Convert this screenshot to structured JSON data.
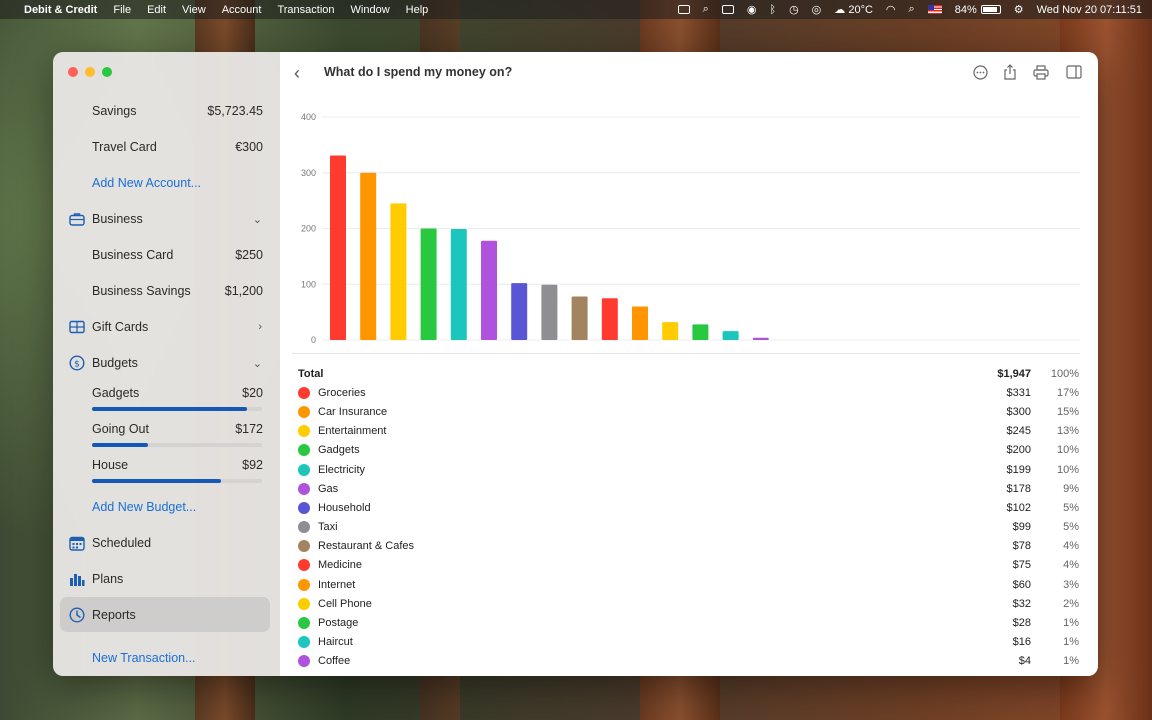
{
  "menubar": {
    "app_name": "Debit & Credit",
    "menus": [
      "File",
      "Edit",
      "View",
      "Account",
      "Transaction",
      "Window",
      "Help"
    ],
    "weather": "20°C",
    "battery": "84%",
    "clock": "Wed Nov 20  07:11:51"
  },
  "sidebar": {
    "accounts": [
      {
        "label": "Savings",
        "amount": "$5,723.45"
      },
      {
        "label": "Travel Card",
        "amount": "€300"
      }
    ],
    "add_account": "Add New Account...",
    "business": {
      "label": "Business",
      "items": [
        {
          "label": "Business Card",
          "amount": "$250"
        },
        {
          "label": "Business Savings",
          "amount": "$1,200"
        }
      ]
    },
    "gift_cards": "Gift Cards",
    "budgets": {
      "label": "Budgets",
      "items": [
        {
          "label": "Gadgets",
          "amount": "$20",
          "progress": 0.91
        },
        {
          "label": "Going Out",
          "amount": "$172",
          "progress": 0.33
        },
        {
          "label": "House",
          "amount": "$92",
          "progress": 0.76
        }
      ]
    },
    "add_budget": "Add New Budget...",
    "scheduled": "Scheduled",
    "plans": "Plans",
    "reports": "Reports",
    "new_transaction": "New Transaction..."
  },
  "main": {
    "title": "What do I spend my money on?"
  },
  "chart_data": {
    "type": "bar",
    "categories": [
      "Groceries",
      "Car Insurance",
      "Entertainment",
      "Gadgets",
      "Electricity",
      "Gas",
      "Household",
      "Taxi",
      "Restaurant & Cafes",
      "Medicine",
      "Internet",
      "Cell Phone",
      "Postage",
      "Haircut",
      "Coffee"
    ],
    "values": [
      331,
      300,
      245,
      200,
      199,
      178,
      102,
      99,
      78,
      75,
      60,
      32,
      28,
      16,
      4
    ],
    "colors": [
      "#ff3b30",
      "#ff9500",
      "#ffcc00",
      "#28c840",
      "#1bc6bc",
      "#af52de",
      "#5856d6",
      "#8e8e93",
      "#a2845e",
      "#ff3b30",
      "#ff9500",
      "#ffcc00",
      "#28c840",
      "#1bc6bc",
      "#af52de"
    ],
    "yticks": [
      0,
      100,
      200,
      300,
      400
    ],
    "ylim": [
      0,
      400
    ],
    "grid": true
  },
  "table": {
    "total": {
      "label": "Total",
      "amount": "$1,947",
      "pct": "100%"
    },
    "rows": [
      {
        "label": "Groceries",
        "amount": "$331",
        "pct": "17%",
        "color": "#ff3b30"
      },
      {
        "label": "Car Insurance",
        "amount": "$300",
        "pct": "15%",
        "color": "#ff9500"
      },
      {
        "label": "Entertainment",
        "amount": "$245",
        "pct": "13%",
        "color": "#ffcc00"
      },
      {
        "label": "Gadgets",
        "amount": "$200",
        "pct": "10%",
        "color": "#28c840"
      },
      {
        "label": "Electricity",
        "amount": "$199",
        "pct": "10%",
        "color": "#1bc6bc"
      },
      {
        "label": "Gas",
        "amount": "$178",
        "pct": "9%",
        "color": "#af52de"
      },
      {
        "label": "Household",
        "amount": "$102",
        "pct": "5%",
        "color": "#5856d6"
      },
      {
        "label": "Taxi",
        "amount": "$99",
        "pct": "5%",
        "color": "#8e8e93"
      },
      {
        "label": "Restaurant & Cafes",
        "amount": "$78",
        "pct": "4%",
        "color": "#a2845e"
      },
      {
        "label": "Medicine",
        "amount": "$75",
        "pct": "4%",
        "color": "#ff3b30"
      },
      {
        "label": "Internet",
        "amount": "$60",
        "pct": "3%",
        "color": "#ff9500"
      },
      {
        "label": "Cell Phone",
        "amount": "$32",
        "pct": "2%",
        "color": "#ffcc00"
      },
      {
        "label": "Postage",
        "amount": "$28",
        "pct": "1%",
        "color": "#28c840"
      },
      {
        "label": "Haircut",
        "amount": "$16",
        "pct": "1%",
        "color": "#1bc6bc"
      },
      {
        "label": "Coffee",
        "amount": "$4",
        "pct": "1%",
        "color": "#af52de"
      }
    ]
  }
}
